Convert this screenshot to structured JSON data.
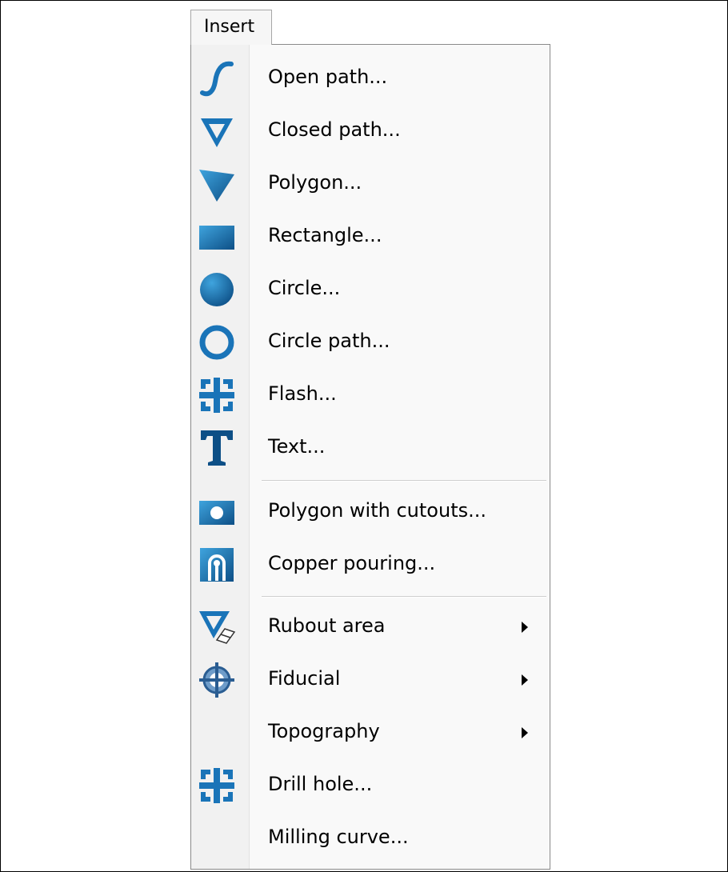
{
  "menubar": {
    "tab_label": "Insert"
  },
  "menu": {
    "items": [
      {
        "label": "Open path...",
        "icon": "open-path-icon"
      },
      {
        "label": "Closed path...",
        "icon": "closed-path-icon"
      },
      {
        "label": "Polygon...",
        "icon": "polygon-icon"
      },
      {
        "label": "Rectangle...",
        "icon": "rectangle-icon"
      },
      {
        "label": "Circle...",
        "icon": "circle-icon"
      },
      {
        "label": "Circle path...",
        "icon": "circle-path-icon"
      },
      {
        "label": "Flash...",
        "icon": "flash-icon"
      },
      {
        "label": "Text...",
        "icon": "text-icon"
      },
      {
        "label": "Polygon with cutouts...",
        "icon": "polygon-cutouts-icon"
      },
      {
        "label": "Copper pouring...",
        "icon": "copper-pouring-icon"
      },
      {
        "label": "Rubout area",
        "icon": "rubout-area-icon",
        "submenu": true
      },
      {
        "label": "Fiducial",
        "icon": "fiducial-icon",
        "submenu": true
      },
      {
        "label": "Topography",
        "submenu": true
      },
      {
        "label": "Drill hole...",
        "icon": "drill-hole-icon"
      },
      {
        "label": "Milling curve..."
      }
    ]
  },
  "colors": {
    "icon_blue": "#1a74b8",
    "icon_light": "#3fa4de",
    "icon_dark": "#0d4f86"
  }
}
